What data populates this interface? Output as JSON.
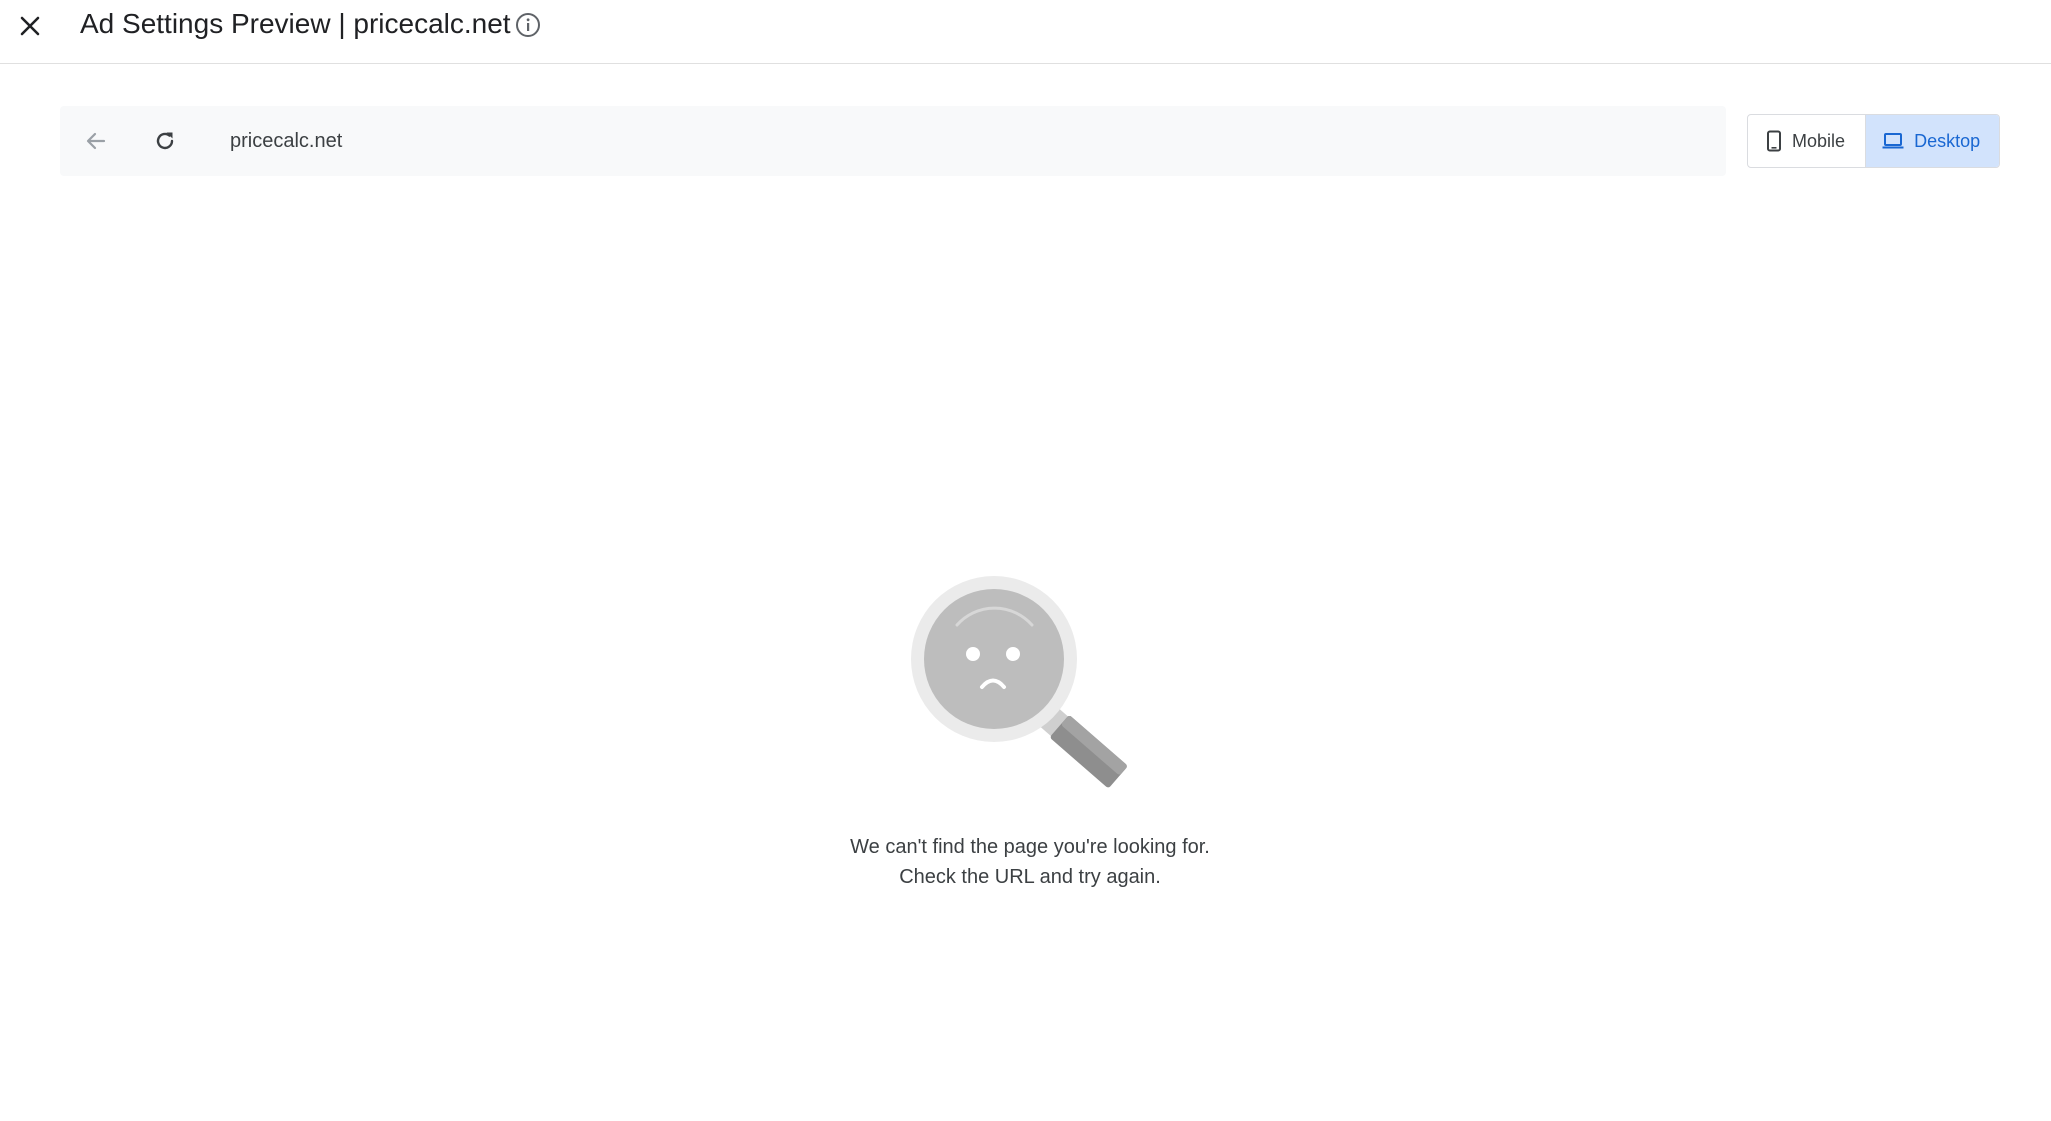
{
  "header": {
    "title": "Ad Settings Preview | pricecalc.net",
    "close_icon": "close-icon",
    "info_icon": "info-icon"
  },
  "browser": {
    "url": "pricecalc.net",
    "back_icon": "arrow-back-icon",
    "reload_icon": "reload-icon"
  },
  "device_toggle": {
    "mobile_label": "Mobile",
    "desktop_label": "Desktop",
    "selected": "Desktop"
  },
  "error": {
    "illustration": "sad-magnifier-icon",
    "line1": "We can't find the page you're looking for.",
    "line2": "Check the URL and try again."
  },
  "colors": {
    "selected_bg": "#d2e3fc",
    "selected_text": "#1967d2",
    "urlbar_bg": "#f8f9fa"
  }
}
